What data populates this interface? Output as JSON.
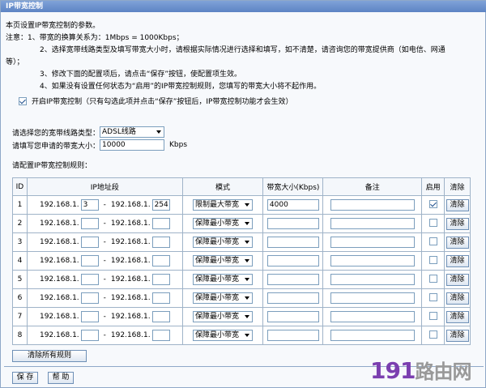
{
  "window": {
    "title": "IP带宽控制"
  },
  "notes": {
    "line1": "本页设置IP带宽控制的参数。",
    "line2": "注意：1、带宽的换算关系为：1Mbps = 1000Kbps；",
    "line3": "2、选择宽带线路类型及填写带宽大小时，请根据实际情况进行选择和填写，如不清楚，请咨询您的带宽提供商（如电信、网通",
    "line4": "等）；",
    "line5": "3、修改下面的配置项后，请点击“保存”按钮，使配置项生效。",
    "line6": "4、如果没有设置任何状态为“启用”的IP带宽控制规则，您填写的带宽大小将不起作用。"
  },
  "enable": {
    "checked": true,
    "label": "开启IP带宽控制（只有勾选此项并点击“保存”按钮后，IP带宽控制功能才会生效）"
  },
  "line_type": {
    "label": "请选择您的宽带线路类型：",
    "value": "ADSL线路"
  },
  "bandwidth": {
    "label": "请填写您申请的带宽大小：",
    "value": "10000",
    "unit": "Kbps"
  },
  "rules_label": "请配置IP带宽控制规则：",
  "table": {
    "headers": {
      "id": "ID",
      "ip": "IP地址段",
      "mode": "模式",
      "bw": "带宽大小(Kbps)",
      "note": "备注",
      "enabled": "启用",
      "clear": "清除"
    },
    "ip_prefix": "192.168.1.",
    "dash": "-",
    "clear_label": "清除",
    "rows": [
      {
        "id": "1",
        "start": "3",
        "end": "254",
        "mode": "限制最大带宽",
        "bw": "4000",
        "note": "",
        "enabled": true
      },
      {
        "id": "2",
        "start": "",
        "end": "",
        "mode": "保障最小带宽",
        "bw": "",
        "note": "",
        "enabled": false
      },
      {
        "id": "3",
        "start": "",
        "end": "",
        "mode": "保障最小带宽",
        "bw": "",
        "note": "",
        "enabled": false
      },
      {
        "id": "4",
        "start": "",
        "end": "",
        "mode": "保障最小带宽",
        "bw": "",
        "note": "",
        "enabled": false
      },
      {
        "id": "5",
        "start": "",
        "end": "",
        "mode": "保障最小带宽",
        "bw": "",
        "note": "",
        "enabled": false
      },
      {
        "id": "6",
        "start": "",
        "end": "",
        "mode": "保障最小带宽",
        "bw": "",
        "note": "",
        "enabled": false
      },
      {
        "id": "7",
        "start": "",
        "end": "",
        "mode": "保障最小带宽",
        "bw": "",
        "note": "",
        "enabled": false
      },
      {
        "id": "8",
        "start": "",
        "end": "",
        "mode": "保障最小带宽",
        "bw": "",
        "note": "",
        "enabled": false
      }
    ]
  },
  "buttons": {
    "clear_all": "清除所有规则",
    "save": "保 存",
    "help": "帮 助"
  },
  "watermark": {
    "digits": "191",
    "text": "路由网"
  }
}
